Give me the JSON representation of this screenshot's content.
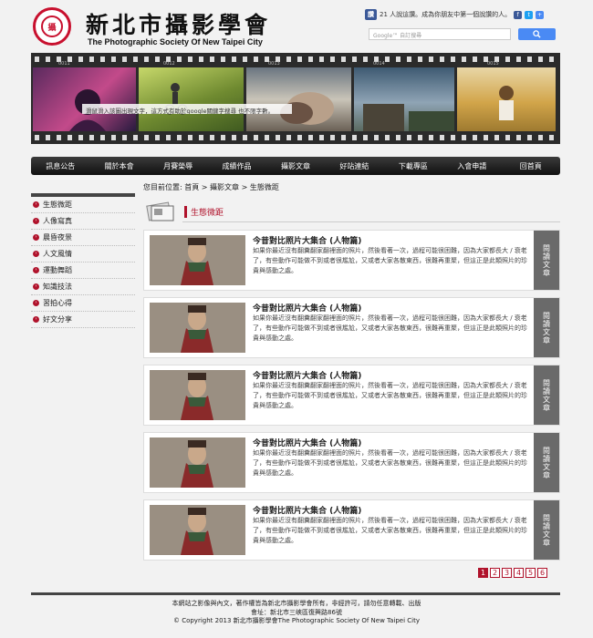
{
  "header": {
    "logo_text": "新北市攝影學會",
    "title": "新北市攝影學會",
    "subtitle": "The Photographic Society Of New Taipei City",
    "fb_like": "讚",
    "fb_text": "21 人說這讚。成為你朋友中第一個說讚的人。",
    "search_placeholder": "Google™ 自訂搜尋",
    "search_icon": "search-icon"
  },
  "hero": {
    "frame_numbers": [
      "0011",
      "0012",
      "0013",
      "0014",
      "0015"
    ],
    "caption": "滑鼠滑入該圖出現文字，這方式有助於google關鍵字搜尋 也不限字數。"
  },
  "nav": {
    "items": [
      "訊息公告",
      "關於本會",
      "月賽榮辱",
      "成績作品",
      "攝影文章",
      "好站連結",
      "下載專區",
      "入會申請",
      "回首頁"
    ]
  },
  "breadcrumb": "您目前位置: 首頁 > 攝影文章 > 生態微距",
  "sidebar": {
    "items": [
      "生態微距",
      "人像寫真",
      "晨昏夜景",
      "人文風情",
      "運動舞蹈",
      "知識技法",
      "習拍心得",
      "好文分享"
    ]
  },
  "section": {
    "title": "生態微距"
  },
  "articles": [
    {
      "title": "今昔對比照片大集合 (人物篇)",
      "excerpt": "如果你最近沒有翻糞翻家翻裡面的照片，然後看著一次，過程可能很困難，因為大家都長大 / 衰老了，有些動作可能做不到或者很尷尬，又或者大家各散東西，很難再重聚，但這正是此類照片的珍貴與感動之處。",
      "read": "閱讀文章"
    },
    {
      "title": "今昔對比照片大集合 (人物篇)",
      "excerpt": "如果你最近沒有翻糞翻家翻裡面的照片，然後看著一次，過程可能很困難，因為大家都長大 / 衰老了，有些動作可能做不到或者很尷尬，又或者大家各散東西，很難再重聚，但這正是此類照片的珍貴與感動之處。",
      "read": "閱讀文章"
    },
    {
      "title": "今昔對比照片大集合 (人物篇)",
      "excerpt": "如果你最近沒有翻糞翻家翻裡面的照片，然後看著一次，過程可能很困難，因為大家都長大 / 衰老了，有些動作可能做不到或者很尷尬，又或者大家各散東西，很難再重聚，但這正是此類照片的珍貴與感動之處。",
      "read": "閱讀文章"
    },
    {
      "title": "今昔對比照片大集合 (人物篇)",
      "excerpt": "如果你最近沒有翻糞翻家翻裡面的照片，然後看著一次，過程可能很困難，因為大家都長大 / 衰老了，有些動作可能做不到或者很尷尬，又或者大家各散東西，很難再重聚，但這正是此類照片的珍貴與感動之處。",
      "read": "閱讀文章"
    },
    {
      "title": "今昔對比照片大集合 (人物篇)",
      "excerpt": "如果你最近沒有翻糞翻家翻裡面的照片，然後看著一次，過程可能很困難，因為大家都長大 / 衰老了，有些動作可能做不到或者很尷尬，又或者大家各散東西，很難再重聚，但這正是此類照片的珍貴與感動之處。",
      "read": "閱讀文章"
    }
  ],
  "pagination": {
    "pages": [
      "1",
      "2",
      "3",
      "4",
      "5",
      "6"
    ],
    "current": "1"
  },
  "footer": {
    "line1": "本網站之影像與內文，著作權皆為新北市攝影學會所有，非經許可，請勿任意轉載、出版",
    "line2": "會址：新北市三峽區復興路86號",
    "line3": "© Copyright 2013 新北市攝影學會The Photographic Society Of New Taipei City"
  },
  "colors": {
    "accent": "#b0122b",
    "nav_bg": "#1e1e1e"
  }
}
